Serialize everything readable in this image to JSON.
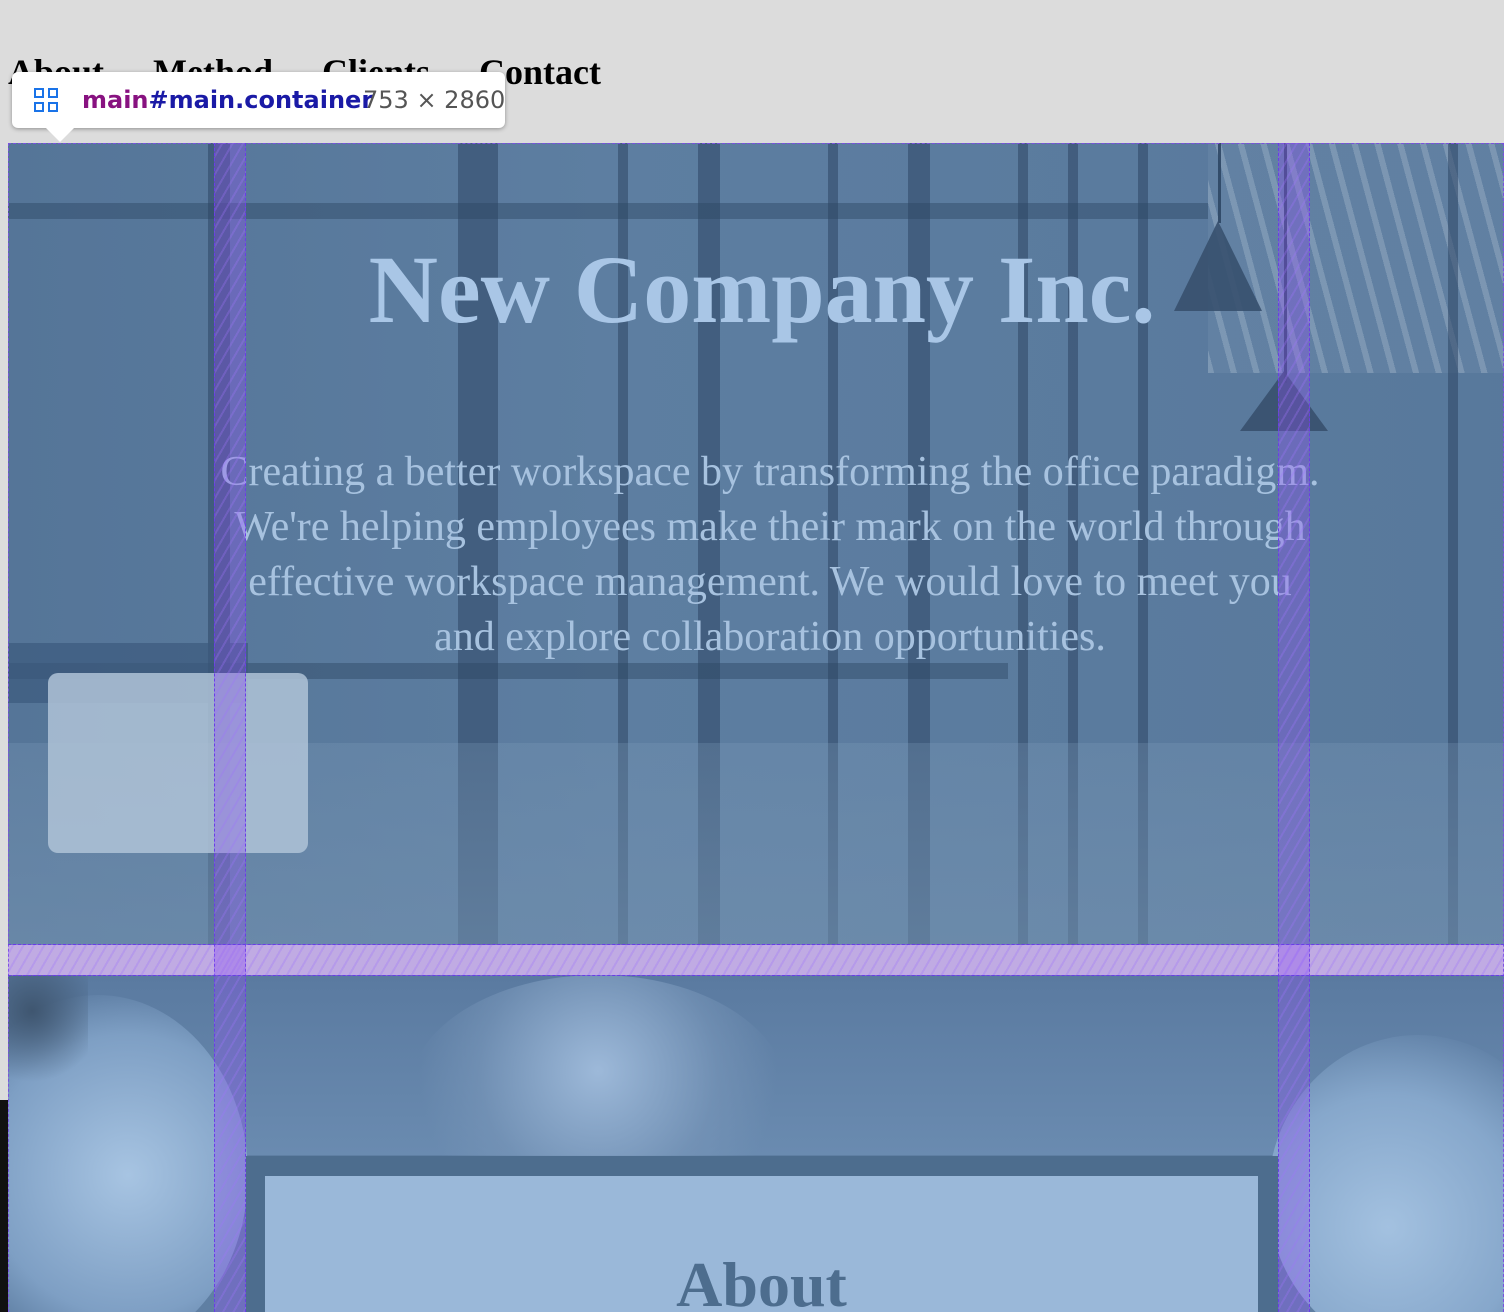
{
  "nav": {
    "items": [
      {
        "label": "About"
      },
      {
        "label": "Method"
      },
      {
        "label": "Clients"
      },
      {
        "label": "Contact"
      }
    ]
  },
  "devtools_tooltip": {
    "tag": "main",
    "selector": "#main.container",
    "dimensions": "753 × 2860",
    "icon": "grid-layout-icon",
    "colors": {
      "tag": "#881280",
      "selector": "#1a1aa6",
      "overlay": "#7b4fe0"
    }
  },
  "hero": {
    "title": "New Company Inc.",
    "text": "Creating a better workspace by transforming the office paradigm. We're helping employees make their mark on the world through effective workspace management. We would love to meet you and explore collaboration opportunities."
  },
  "about": {
    "title": "About"
  },
  "colors": {
    "hero_text": "#a9c6e6",
    "hero_overlay": "#5d7ea1",
    "card_border": "#4d6d8e",
    "card_bg": "#9ab8d9",
    "nav_bg": "#dcdcdc"
  }
}
